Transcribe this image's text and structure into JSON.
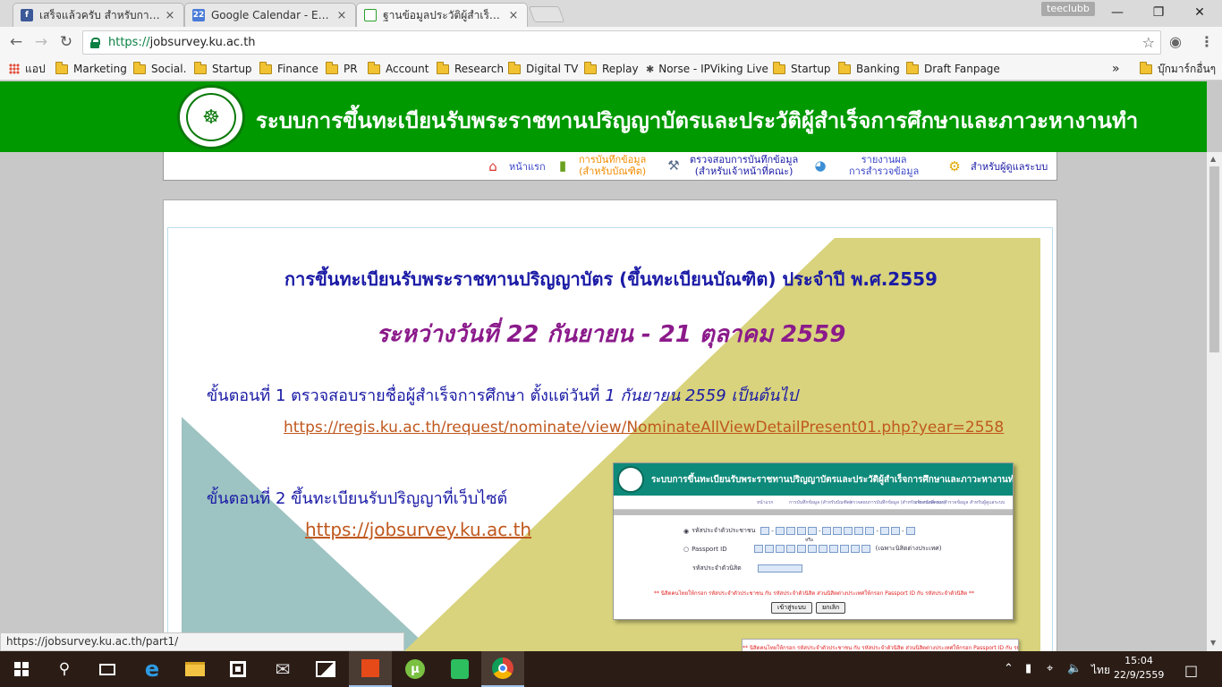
{
  "browser": {
    "tabs": [
      {
        "title": "เสร็จแล้วครับ สำหรับการลงทะ",
        "favicon": "facebook-icon",
        "favicon_text": "f",
        "color": "#3b5998",
        "active": false
      },
      {
        "title": "Google Calendar - Event",
        "favicon": "calendar-icon",
        "favicon_text": "22",
        "color": "#4a7bd8",
        "active": false
      },
      {
        "title": "ฐานข้อมูลประวัติผู้สำเร็จการศึ",
        "favicon": "page-icon",
        "favicon_text": "",
        "color": "#2ca02c",
        "active": true
      }
    ],
    "tab_close": "×",
    "profile_name": "teeclubb",
    "window_controls": {
      "minimize": "—",
      "restore": "❐",
      "close": "✕"
    },
    "url_scheme": "https://",
    "url_host": "jobsurvey.ku.ac.th",
    "bookmarks": [
      {
        "label": "แอป",
        "type": "apps"
      },
      {
        "label": "Marketing",
        "type": "folder"
      },
      {
        "label": "Social.",
        "type": "folder"
      },
      {
        "label": "Startup",
        "type": "folder"
      },
      {
        "label": "Finance",
        "type": "folder"
      },
      {
        "label": "PR",
        "type": "folder"
      },
      {
        "label": "Account",
        "type": "folder"
      },
      {
        "label": "Research",
        "type": "folder"
      },
      {
        "label": "Digital TV",
        "type": "folder"
      },
      {
        "label": "Replay",
        "type": "folder"
      },
      {
        "label": "Norse - IPViking Live",
        "type": "site"
      },
      {
        "label": "Startup",
        "type": "folder"
      },
      {
        "label": "Banking",
        "type": "folder"
      },
      {
        "label": "Draft Fanpage",
        "type": "folder"
      }
    ],
    "bookmarks_overflow": "»",
    "other_bookmarks": "บุ๊กมาร์กอื่นๆ",
    "status_url": "https://jobsurvey.ku.ac.th/part1/"
  },
  "site": {
    "title": "ระบบการขึ้นทะเบียนรับพระราชทานปริญญาบัตรและประวัติผู้สำเร็จการศึกษาและภาวะหางานทำ",
    "menu": {
      "home": "หน้าแรก",
      "record_line1": "การบันทึกข้อมูล",
      "record_line2": "(สำหรับบัณฑิต)",
      "check_line1": "ตรวจสอบการบันทึกข้อมูล",
      "check_line2": "(สำหรับเจ้าหน้าที่คณะ)",
      "report_line1": "รายงานผล",
      "report_line2": "การสำรวจข้อมูล",
      "admin": "สำหรับผู้ดูแลระบบ"
    }
  },
  "announcement": {
    "headline": "การขึ้นทะเบียนรับพระราชทานปริญญาบัตร (ขึ้นทะเบียนบัณฑิต) ประจำปี พ.ศ.2559",
    "period": "ระหว่างวันที่  22 กันยายน - 21 ตุลาคม 2559",
    "step1_prefix": "ขั้นตอนที่ 1 ตรวจสอบรายชื่อผู้สำเร็จการศึกษา ตั้งแต่วันที่ ",
    "step1_date": "1 กันยายน 2559 เป็นต้นไป",
    "step1_link": "https://regis.ku.ac.th/request/nominate/view/NominateAllViewDetailPresent01.php?year=2558",
    "step2": "ขั้นตอนที่ 2 ขึ้นทะเบียนรับปริญญาที่เว็บไซต์",
    "step2_link": "https://jobsurvey.ku.ac.th",
    "mini": {
      "title": "ระบบการขึ้นทะเบียนรับพระราชทานปริญญาบัตรและประวัติผู้สำเร็จการศึกษาและภาวะหางานทำ",
      "menu": [
        "หน้าแรก",
        "การบันทึกข้อมูล (สำหรับบัณฑิต)",
        "ตรวจสอบการบันทึกข้อมูล (สำหรับเจ้าหน้าที่คณะ)",
        "รายงานผล การสำรวจข้อมูล",
        "สำหรับผู้ดูแลระบบ"
      ],
      "id_label": "รหัสประจำตัวประชาชน",
      "or": "หรือ",
      "passport_label": "Passport ID",
      "passport_note": "(เฉพาะนิสิตต่างประเทศ)",
      "student_label": "รหัสประจำตัวนิสิต",
      "warning": "** นิสิตคนไทยให้กรอก รหัสประจำตัวประชาชน กับ รหัสประจำตัวนิสิต ส่วนนิสิตต่างประเทศให้กรอก Passport ID กับ รหัสประจำตัวนิสิต **",
      "login_button": "เข้าสู่ระบบ",
      "cancel_button": "ยกเลิก"
    }
  },
  "taskbar": {
    "language": "ไทย",
    "time": "15:04",
    "date": "22/9/2559"
  }
}
